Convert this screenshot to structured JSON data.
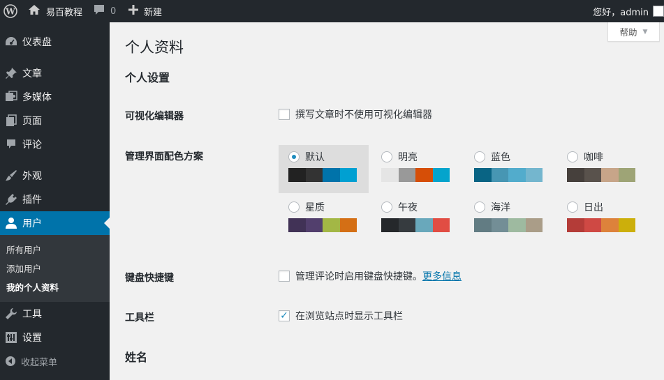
{
  "adminbar": {
    "site_name": "易百教程",
    "comment_count": "0",
    "new_label": "新建",
    "greeting": "您好，admin"
  },
  "sidebar": {
    "items": [
      {
        "label": "仪表盘",
        "icon": "dashboard-icon"
      },
      {
        "label": "文章",
        "icon": "pushpin-icon"
      },
      {
        "label": "多媒体",
        "icon": "media-icon"
      },
      {
        "label": "页面",
        "icon": "pages-icon"
      },
      {
        "label": "评论",
        "icon": "comment-icon"
      },
      {
        "label": "外观",
        "icon": "paintbrush-icon"
      },
      {
        "label": "插件",
        "icon": "plugin-icon"
      },
      {
        "label": "用户",
        "icon": "user-icon",
        "active": true
      },
      {
        "label": "工具",
        "icon": "wrench-icon"
      },
      {
        "label": "设置",
        "icon": "settings-icon"
      }
    ],
    "submenu": [
      "所有用户",
      "添加用户",
      "我的个人资料"
    ],
    "collapse_label": "收起菜单"
  },
  "main": {
    "help_label": "帮助",
    "page_title": "个人资料",
    "section_personal": "个人设置",
    "visual_editor": {
      "label": "可视化编辑器",
      "option": "撰写文章时不使用可视化编辑器",
      "checked": false
    },
    "color_scheme": {
      "label": "管理界面配色方案",
      "schemes": [
        {
          "name": "默认",
          "selected": true,
          "colors": [
            "#222222",
            "#333333",
            "#0073aa",
            "#00a0d2"
          ]
        },
        {
          "name": "明亮",
          "selected": false,
          "colors": [
            "#e5e5e5",
            "#999999",
            "#d64e07",
            "#04a4cc"
          ]
        },
        {
          "name": "蓝色",
          "selected": false,
          "colors": [
            "#096484",
            "#4796b3",
            "#52accc",
            "#74b6ce"
          ]
        },
        {
          "name": "咖啡",
          "selected": false,
          "colors": [
            "#46403c",
            "#59524c",
            "#c7a589",
            "#9ea476"
          ]
        },
        {
          "name": "星质",
          "selected": false,
          "colors": [
            "#413256",
            "#523f6d",
            "#a3b745",
            "#d46f15"
          ]
        },
        {
          "name": "午夜",
          "selected": false,
          "colors": [
            "#25282b",
            "#363b3f",
            "#69a8bb",
            "#e14d43"
          ]
        },
        {
          "name": "海洋",
          "selected": false,
          "colors": [
            "#627c83",
            "#738e96",
            "#9ebaa0",
            "#aa9d88"
          ]
        },
        {
          "name": "日出",
          "selected": false,
          "colors": [
            "#b43c38",
            "#cf4944",
            "#dd823b",
            "#ccaf0b"
          ]
        }
      ]
    },
    "keyboard_shortcuts": {
      "label": "键盘快捷键",
      "option": "管理评论时启用键盘快捷键。",
      "link": "更多信息",
      "checked": false
    },
    "toolbar": {
      "label": "工具栏",
      "option": "在浏览站点时显示工具栏",
      "checked": true
    },
    "section_name": "姓名"
  }
}
